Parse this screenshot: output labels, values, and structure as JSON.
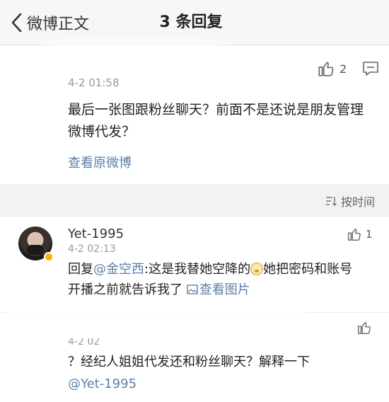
{
  "nav": {
    "back_label": "微博正文",
    "title": "3 条回复"
  },
  "main_comment": {
    "like_count": "2",
    "time": "4-2 01:58",
    "text": "最后一张图跟粉丝聊天？前面不是还说是朋友管理微博代发？",
    "view_original": "查看原微博"
  },
  "sort": {
    "label": "按时间"
  },
  "replies": [
    {
      "username": "Yet-1995",
      "time": "4-2 02:13",
      "like_count": "1",
      "prefix": "回复",
      "mention": "@金空西",
      "text_a": ":这是我替她空降的",
      "text_b": "她把密码和账号开播之前就告诉我了",
      "link": "查看图片"
    },
    {
      "time": "4-2 02",
      "text": "？经纪人姐姐代发还和粉丝聊天？解释一下",
      "mention": "@Yet-1995"
    }
  ],
  "icons": {
    "back": "chevron-left-icon",
    "like": "thumbs-up-icon",
    "comment": "comment-bubble-icon",
    "sort": "sort-icon",
    "image": "image-icon",
    "emoji": "smile-emoji-icon"
  },
  "colors": {
    "link": "#5d7fa7",
    "background": "#f2f2f2"
  }
}
